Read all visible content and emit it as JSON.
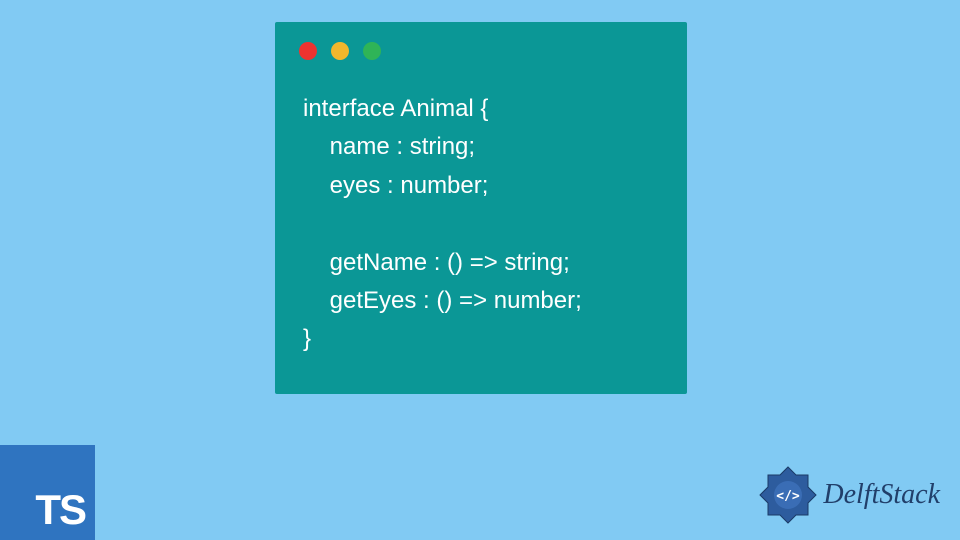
{
  "code": {
    "lines": [
      "interface Animal {",
      "    name : string;",
      "    eyes : number;",
      "",
      "    getName : () => string;",
      "    getEyes : () => number;",
      "}"
    ]
  },
  "ts_badge": {
    "label": "TS"
  },
  "brand": {
    "name": "DelftStack"
  },
  "colors": {
    "background": "#81caf3",
    "code_bg": "#0b9796",
    "ts_bg": "#2f74c0",
    "brand_color": "#213f6a"
  }
}
